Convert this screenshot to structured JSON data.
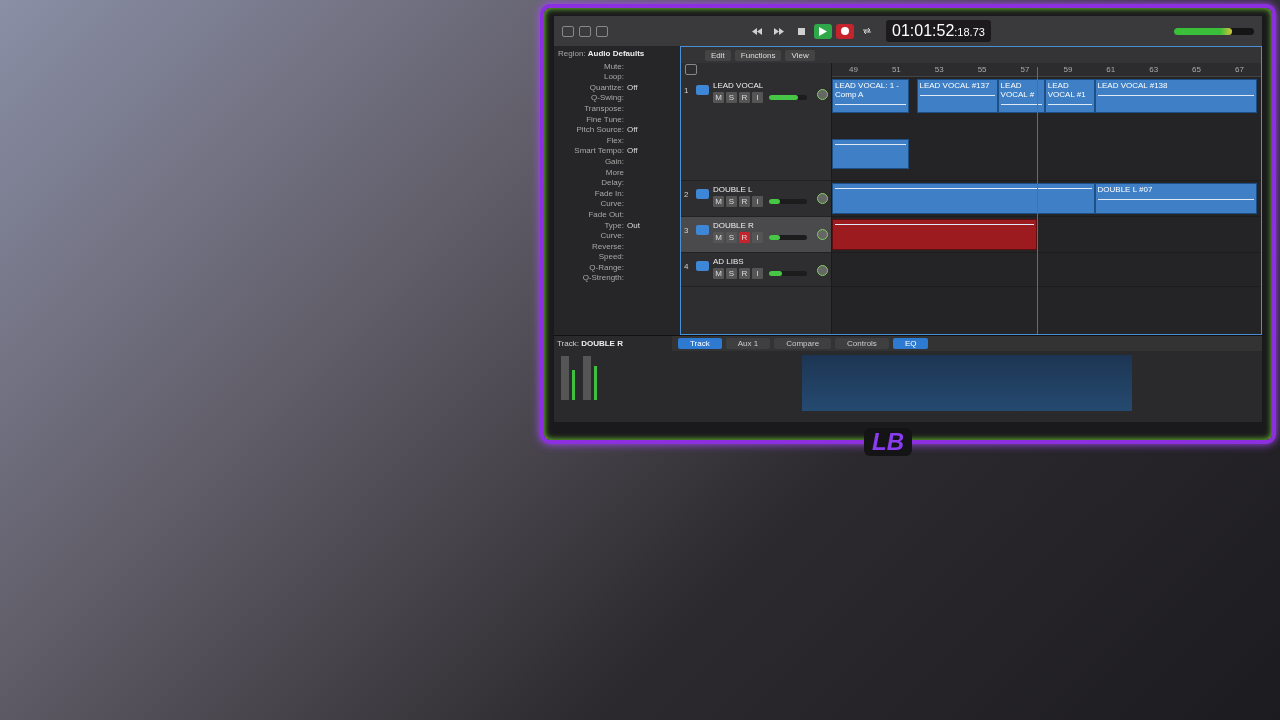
{
  "transport": {
    "buttons": [
      {
        "kind": "rewind",
        "on": false
      },
      {
        "kind": "forward",
        "on": false
      },
      {
        "kind": "stop",
        "on": false
      },
      {
        "kind": "play",
        "on": true
      },
      {
        "kind": "record",
        "on": true
      },
      {
        "kind": "cycle",
        "on": false
      }
    ],
    "time_main": "01:01:52",
    "time_fraction": ":18.73",
    "master": {
      "level": 0.72
    }
  },
  "inspector": {
    "label": "Region:",
    "value": "Audio Defaults",
    "params": [
      {
        "name": "Mute:"
      },
      {
        "name": "Loop:"
      },
      {
        "name": "Quantize:",
        "value": "Off"
      },
      {
        "name": "Q-Swing:"
      },
      {
        "name": "Transpose:"
      },
      {
        "name": "Fine Tune:"
      },
      {
        "name": "Pitch Source:",
        "value": "Off"
      },
      {
        "name": "Flex:"
      },
      {
        "name": "Smart Tempo:",
        "value": "Off"
      },
      {
        "name": "Gain:"
      },
      {
        "name": "More"
      },
      {
        "name": "Delay:"
      },
      {
        "name": "Fade In:"
      },
      {
        "name": "Curve:"
      },
      {
        "name": "Fade Out:"
      },
      {
        "name": "Type:",
        "value": "Out"
      },
      {
        "name": "Curve:"
      },
      {
        "name": "Reverse:"
      },
      {
        "name": "Speed:"
      },
      {
        "name": "Q-Range:"
      },
      {
        "name": "Q-Strength:"
      }
    ]
  },
  "menus": [
    "Edit",
    "Functions",
    "View"
  ],
  "ruler": [
    "49",
    "51",
    "53",
    "55",
    "57",
    "59",
    "61",
    "63",
    "65",
    "67"
  ],
  "tracks": [
    {
      "number": "1",
      "name": "LEAD VOCAL",
      "selected": false,
      "record_armed": false,
      "level": 0.75,
      "buttons": [
        "M",
        "S",
        "R",
        "I"
      ],
      "regions": [
        {
          "kind": "audio",
          "label": "LEAD VOCAL: 1 - Comp A"
        },
        {
          "kind": "audio",
          "label": "LEAD VOCAL #137"
        },
        {
          "kind": "audio",
          "label": "LEAD VOCAL #"
        },
        {
          "kind": "audio",
          "label": "LEAD VOCAL #1"
        },
        {
          "kind": "audio",
          "label": "LEAD VOCAL #138"
        }
      ]
    },
    {
      "number": "2",
      "name": "DOUBLE L",
      "selected": false,
      "record_armed": false,
      "level": 0.3,
      "buttons": [
        "M",
        "S",
        "R",
        "I"
      ],
      "regions": [
        {
          "kind": "audio"
        },
        {
          "kind": "audio",
          "label": "DOUBLE L #07"
        }
      ]
    },
    {
      "number": "3",
      "name": "DOUBLE R",
      "selected": true,
      "record_armed": true,
      "level": 0.3,
      "buttons": [
        "M",
        "S",
        "R",
        "I"
      ],
      "regions": [
        {
          "kind": "recording"
        }
      ]
    },
    {
      "number": "4",
      "name": "AD LIBS",
      "selected": false,
      "record_armed": false,
      "level": 0.35,
      "buttons": [
        "M",
        "S",
        "R",
        "I"
      ]
    }
  ],
  "footer": {
    "label": "Track:",
    "value": "DOUBLE R",
    "tabs": [
      {
        "label": "Track",
        "selected": true
      },
      {
        "label": "Aux 1",
        "selected": false
      },
      {
        "label": "Compare",
        "selected": false
      },
      {
        "label": "Controls",
        "selected": false
      },
      {
        "label": "EQ",
        "selected": true
      }
    ]
  },
  "logo": "LB"
}
